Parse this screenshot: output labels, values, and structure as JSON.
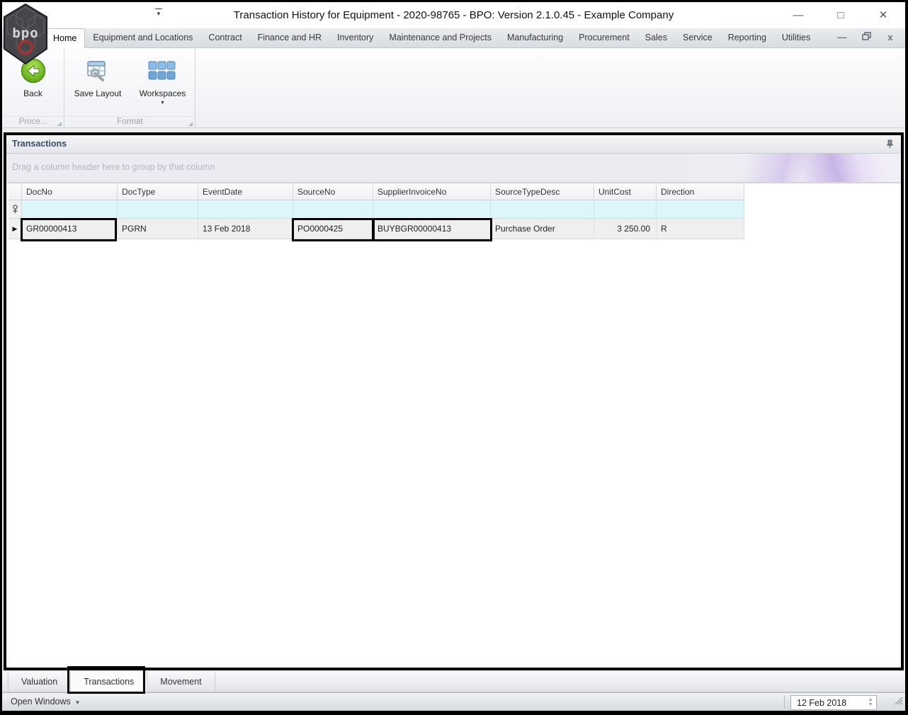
{
  "window": {
    "title": "Transaction History for Equipment - 2020-98765 - BPO: Version 2.1.0.45 - Example Company",
    "logo_text": "bpo",
    "controls": {
      "minimize": "—",
      "maximize": "□",
      "close": "✕"
    }
  },
  "ribbon": {
    "tabs": [
      "Home",
      "Equipment and Locations",
      "Contract",
      "Finance and HR",
      "Inventory",
      "Maintenance and Projects",
      "Manufacturing",
      "Procurement",
      "Sales",
      "Service",
      "Reporting",
      "Utilities"
    ],
    "active_tab": "Home",
    "mdi_controls": {
      "minimize": "—",
      "close": "x"
    },
    "buttons": {
      "back": "Back",
      "save_layout": "Save Layout",
      "workspaces": "Workspaces"
    },
    "groups": [
      {
        "label": "Proce..."
      },
      {
        "label": "Format"
      }
    ]
  },
  "panel": {
    "title": "Transactions",
    "group_by_hint": "Drag a column header here to group by that column"
  },
  "grid": {
    "columns": [
      "DocNo",
      "DocType",
      "EventDate",
      "SourceNo",
      "SupplierInvoiceNo",
      "SourceTypeDesc",
      "UnitCost",
      "Direction"
    ],
    "rows": [
      {
        "DocNo": "GR00000413",
        "DocType": "PGRN",
        "EventDate": "13 Feb 2018",
        "SourceNo": "PO0000425",
        "SupplierInvoiceNo": "BUYBGR00000413",
        "SourceTypeDesc": "Purchase Order",
        "UnitCost": "3 250.00",
        "Direction": "R"
      }
    ]
  },
  "bottom_tabs": [
    "Valuation",
    "Transactions",
    "Movement"
  ],
  "active_bottom_tab": "Transactions",
  "status_bar": {
    "open_windows": "Open Windows",
    "date": "12 Feb 2018"
  },
  "glyphs": {
    "dropdown": "▼",
    "small_dropdown": "▾",
    "row_indicator": "▶",
    "spin_up": "▲",
    "spin_down": "▼"
  },
  "colors": {
    "back_button_green": "#6aae22",
    "workspaces_blue": "#7fb2e0",
    "filter_row_bg": "#dcf6fa",
    "panel_title_text": "#3a4a61",
    "annotation_border": "#000000",
    "swoosh_purple": "#a786db"
  }
}
